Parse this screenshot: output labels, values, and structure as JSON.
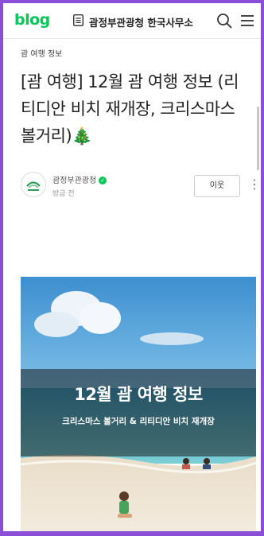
{
  "header": {
    "logo": "blog",
    "blog_name": "괌정부관광청 한국사무소"
  },
  "post": {
    "category": "괌 여행 정보",
    "title": "[괌 여행] 12월 괌 여행 정보 (리티디안 비치 재개장, 크리스마스 볼거리)",
    "title_emoji": "🎄"
  },
  "author": {
    "name": "괌정부관광청",
    "verified_mark": "✓",
    "time": "방금 전",
    "neighbor_button": "이웃",
    "more_icon": "more-vertical-icon"
  },
  "photo": {
    "title": "12월 괌 여행 정보",
    "subtitle": "크리스마스 볼거리 & 리티디안 비치 재개장"
  },
  "colors": {
    "brand_green": "#03c75a",
    "frame": "#8a4fd6"
  }
}
